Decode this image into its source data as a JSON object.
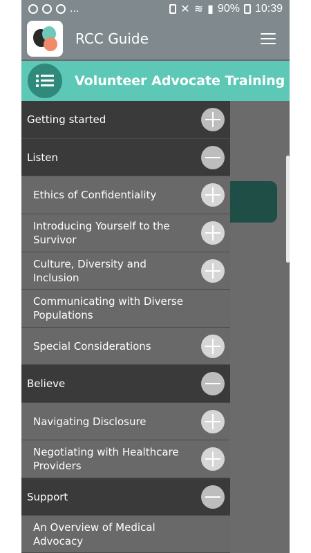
{
  "status_bar": {
    "left_icons": [
      "whatsapp-icon",
      "podcast-icon",
      "podcast-icon"
    ],
    "overflow": "...",
    "battery_percent": "90%",
    "time": "10:39"
  },
  "app_bar": {
    "title": "RCC Guide",
    "menu_icon": "hamburger-menu-icon"
  },
  "section": {
    "title": "Volunteer Advocate Training",
    "icon": "list-icon"
  },
  "drawer": {
    "items": [
      {
        "label": "Getting started",
        "level": "top",
        "toggle": "plus"
      },
      {
        "label": "Listen",
        "level": "top",
        "toggle": "minus"
      },
      {
        "label": "Ethics of Confidentiality",
        "level": "sub",
        "toggle": "plus"
      },
      {
        "label": "Introducing Yourself to the Survivor",
        "level": "sub",
        "toggle": "plus"
      },
      {
        "label": "Culture, Diversity and Inclusion",
        "level": "sub",
        "toggle": "plus"
      },
      {
        "label": "Communicating with Diverse Populations",
        "level": "sub",
        "toggle": ""
      },
      {
        "label": "Special Considerations",
        "level": "sub",
        "toggle": "plus"
      },
      {
        "label": "Believe",
        "level": "top",
        "toggle": "minus"
      },
      {
        "label": "Navigating Disclosure",
        "level": "sub",
        "toggle": "plus"
      },
      {
        "label": "Negotiating with Healthcare Providers",
        "level": "sub",
        "toggle": "plus"
      },
      {
        "label": "Support",
        "level": "top",
        "toggle": "minus"
      },
      {
        "label": "An Overview of Medical Advocacy",
        "level": "sub",
        "toggle": ""
      }
    ]
  },
  "colors": {
    "app_bar": "#808a8e",
    "section_header": "#5cc8b5",
    "section_icon_circle": "#2f8a7b",
    "drawer_top": "#3a3a3a",
    "drawer_sub": "#696969"
  }
}
